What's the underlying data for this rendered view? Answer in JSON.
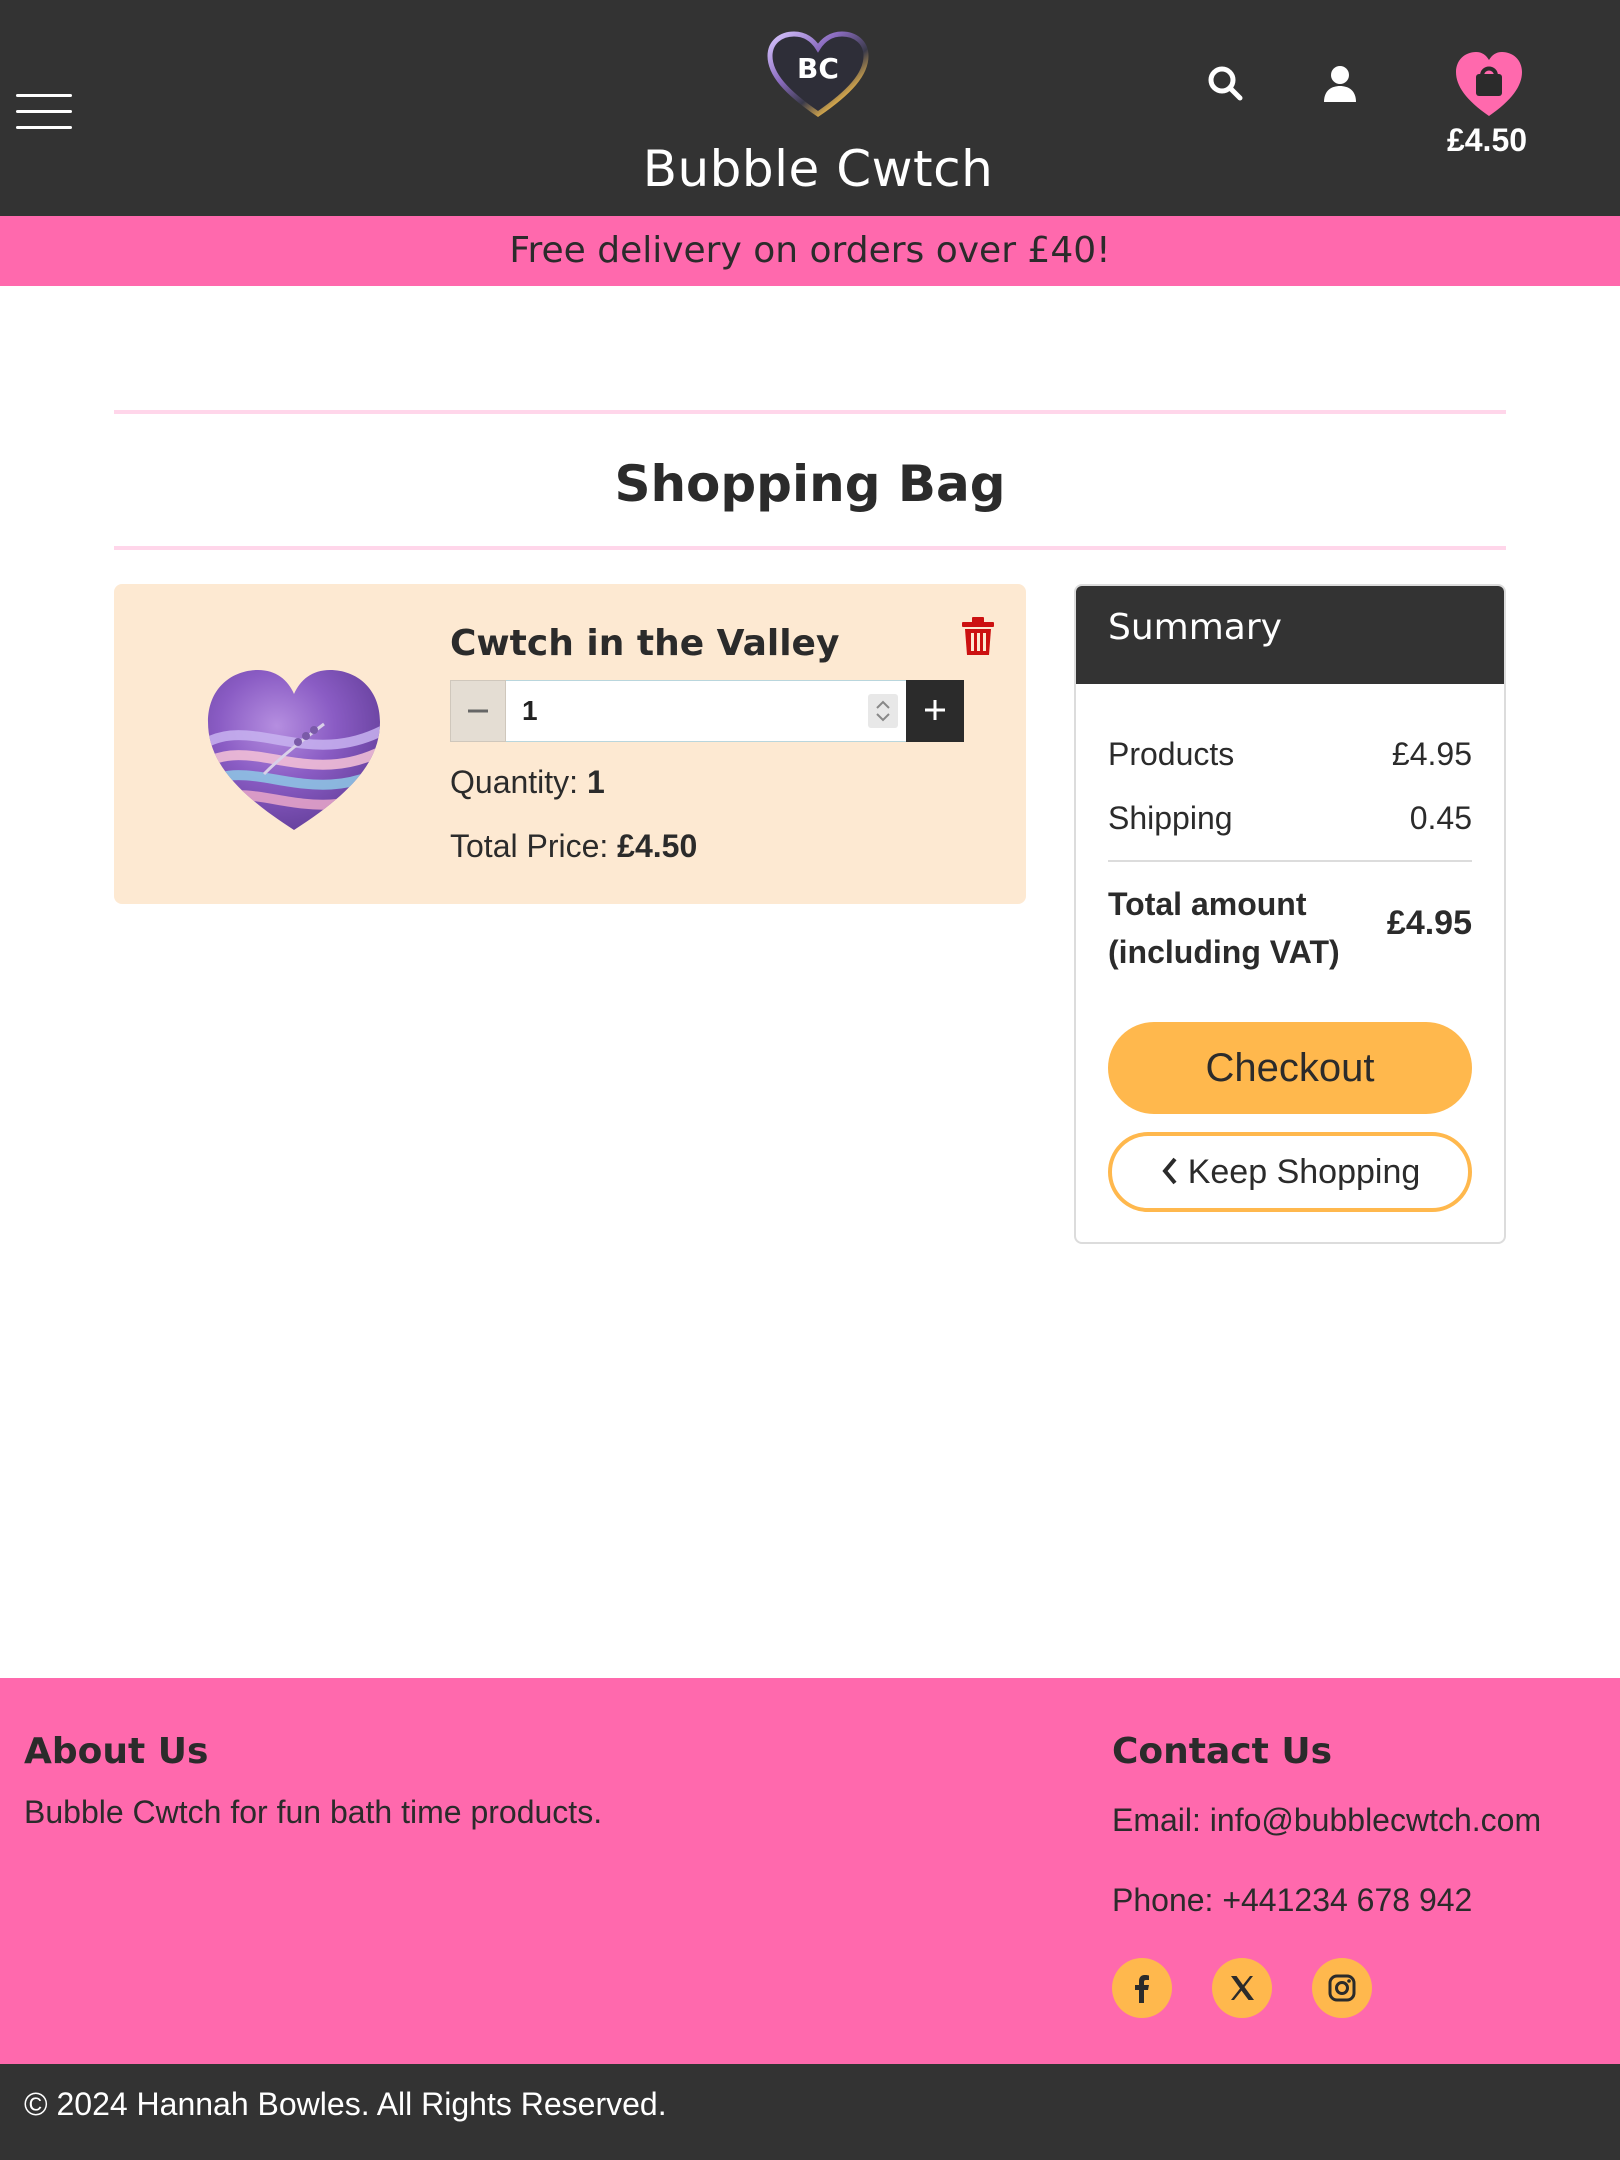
{
  "header": {
    "brand_initials": "BC",
    "brand_name": "Bubble Cwtch",
    "bag_total": "£4.50",
    "icons": {
      "menu": "hamburger-menu-icon",
      "search": "search-icon",
      "account": "user-icon",
      "bag": "shopping-bag-heart-icon"
    }
  },
  "promo": {
    "text": "Free delivery on orders over £40!"
  },
  "page": {
    "title": "Shopping Bag"
  },
  "cart": {
    "items": [
      {
        "name": "Cwtch in the Valley",
        "image": "purple-heart-bath-bomb",
        "quantity_value": "1",
        "quantity_label": "Quantity:",
        "quantity": "1",
        "price_label": "Total Price:",
        "price": "£4.50"
      }
    ]
  },
  "summary": {
    "title": "Summary",
    "products_label": "Products",
    "products_value": "£4.95",
    "shipping_label": "Shipping",
    "shipping_value": "0.45",
    "total_label": "Total amount (including VAT)",
    "total_value": "£4.95",
    "checkout_label": "Checkout",
    "keep_shopping_label": "Keep Shopping"
  },
  "footer": {
    "about_title": "About Us",
    "about_text": "Bubble Cwtch for fun bath time products.",
    "contact_title": "Contact Us",
    "email": "Email: info@bubblecwtch.com",
    "phone": "Phone: +441234 678 942",
    "social": [
      "facebook-icon",
      "x-icon",
      "instagram-icon"
    ],
    "copyright": "© 2024 Hannah Bowles. All Rights Reserved."
  },
  "colors": {
    "header_bg": "#333333",
    "accent_pink": "#ff69ad",
    "accent_orange": "#ffb84d",
    "cart_item_bg": "#fde9d2",
    "trash_red": "#cc1111"
  }
}
